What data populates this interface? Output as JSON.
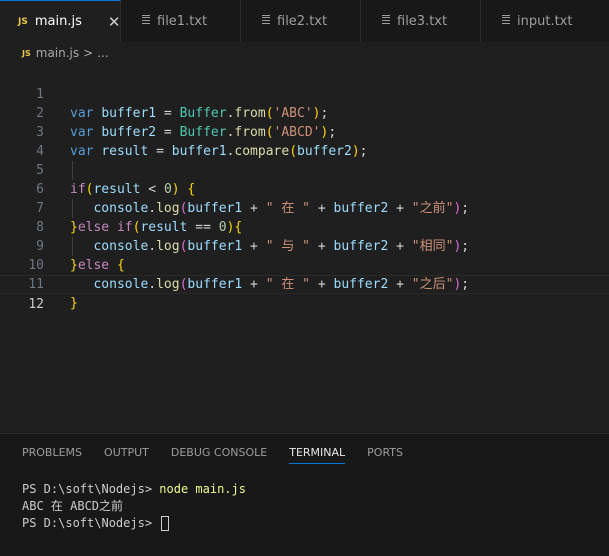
{
  "tabs": [
    {
      "label": "main.js",
      "type": "js",
      "active": true,
      "close": "✕"
    },
    {
      "label": "file1.txt",
      "type": "txt",
      "active": false
    },
    {
      "label": "file2.txt",
      "type": "txt",
      "active": false
    },
    {
      "label": "file3.txt",
      "type": "txt",
      "active": false
    },
    {
      "label": "input.txt",
      "type": "txt",
      "active": false
    }
  ],
  "breadcrumb": {
    "badge": "JS",
    "file": "main.js",
    "sep": ">",
    "more": "..."
  },
  "editor": {
    "line_numbers": [
      "1",
      "2",
      "3",
      "4",
      "5",
      "6",
      "7",
      "8",
      "9",
      "10",
      "11",
      "12"
    ],
    "current_line": "12"
  },
  "panel": {
    "tabs": [
      "PROBLEMS",
      "OUTPUT",
      "DEBUG CONSOLE",
      "TERMINAL",
      "PORTS"
    ],
    "active_tab": "TERMINAL",
    "terminal": {
      "prompt1": "PS D:\\soft\\Nodejs> ",
      "command": "node main.js",
      "output": "ABC 在 ABCD之前",
      "prompt2": "PS D:\\soft\\Nodejs> "
    }
  },
  "colors": {
    "accent": "#0078d4",
    "js_badge": "#e8c84a",
    "background": "#1f1f1f"
  }
}
